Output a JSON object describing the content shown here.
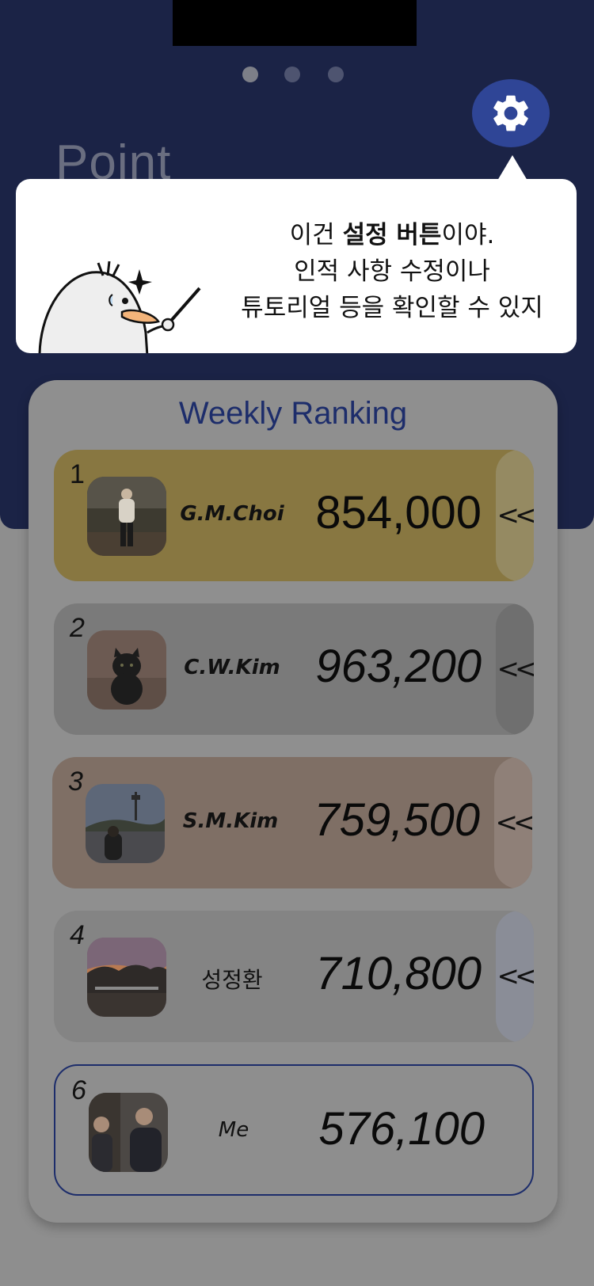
{
  "header": {
    "page_title": "Point",
    "page_dots": [
      "page-1",
      "page-2",
      "page-3"
    ],
    "settings_icon": "gear-icon"
  },
  "tooltip": {
    "line1_prefix": "이건 ",
    "line1_bold": "설정 버튼",
    "line1_suffix": "이야.",
    "line2": "인적 사항 수정이나",
    "line3": "튜토리얼 등을 확인할 수 있지"
  },
  "ranking": {
    "title": "Weekly Ranking",
    "expand_icon": "double-chevron-left-icon",
    "expand_label": "<<",
    "rows": [
      {
        "rank": "1",
        "name": "G.M.Choi",
        "score": "854,000"
      },
      {
        "rank": "2",
        "name": "C.W.Kim",
        "score": "963,200"
      },
      {
        "rank": "3",
        "name": "S.M.Kim",
        "score": "759,500"
      },
      {
        "rank": "4",
        "name": "성정환",
        "score": "710,800"
      }
    ],
    "me": {
      "rank": "6",
      "name": "Me",
      "score": "576,100"
    }
  },
  "colors": {
    "header_bg": "#1b2346",
    "accent_blue": "#2f4596",
    "gold_row": "#887741",
    "silver_row": "#7a7a7a",
    "bronze_row": "#7f6f65"
  }
}
